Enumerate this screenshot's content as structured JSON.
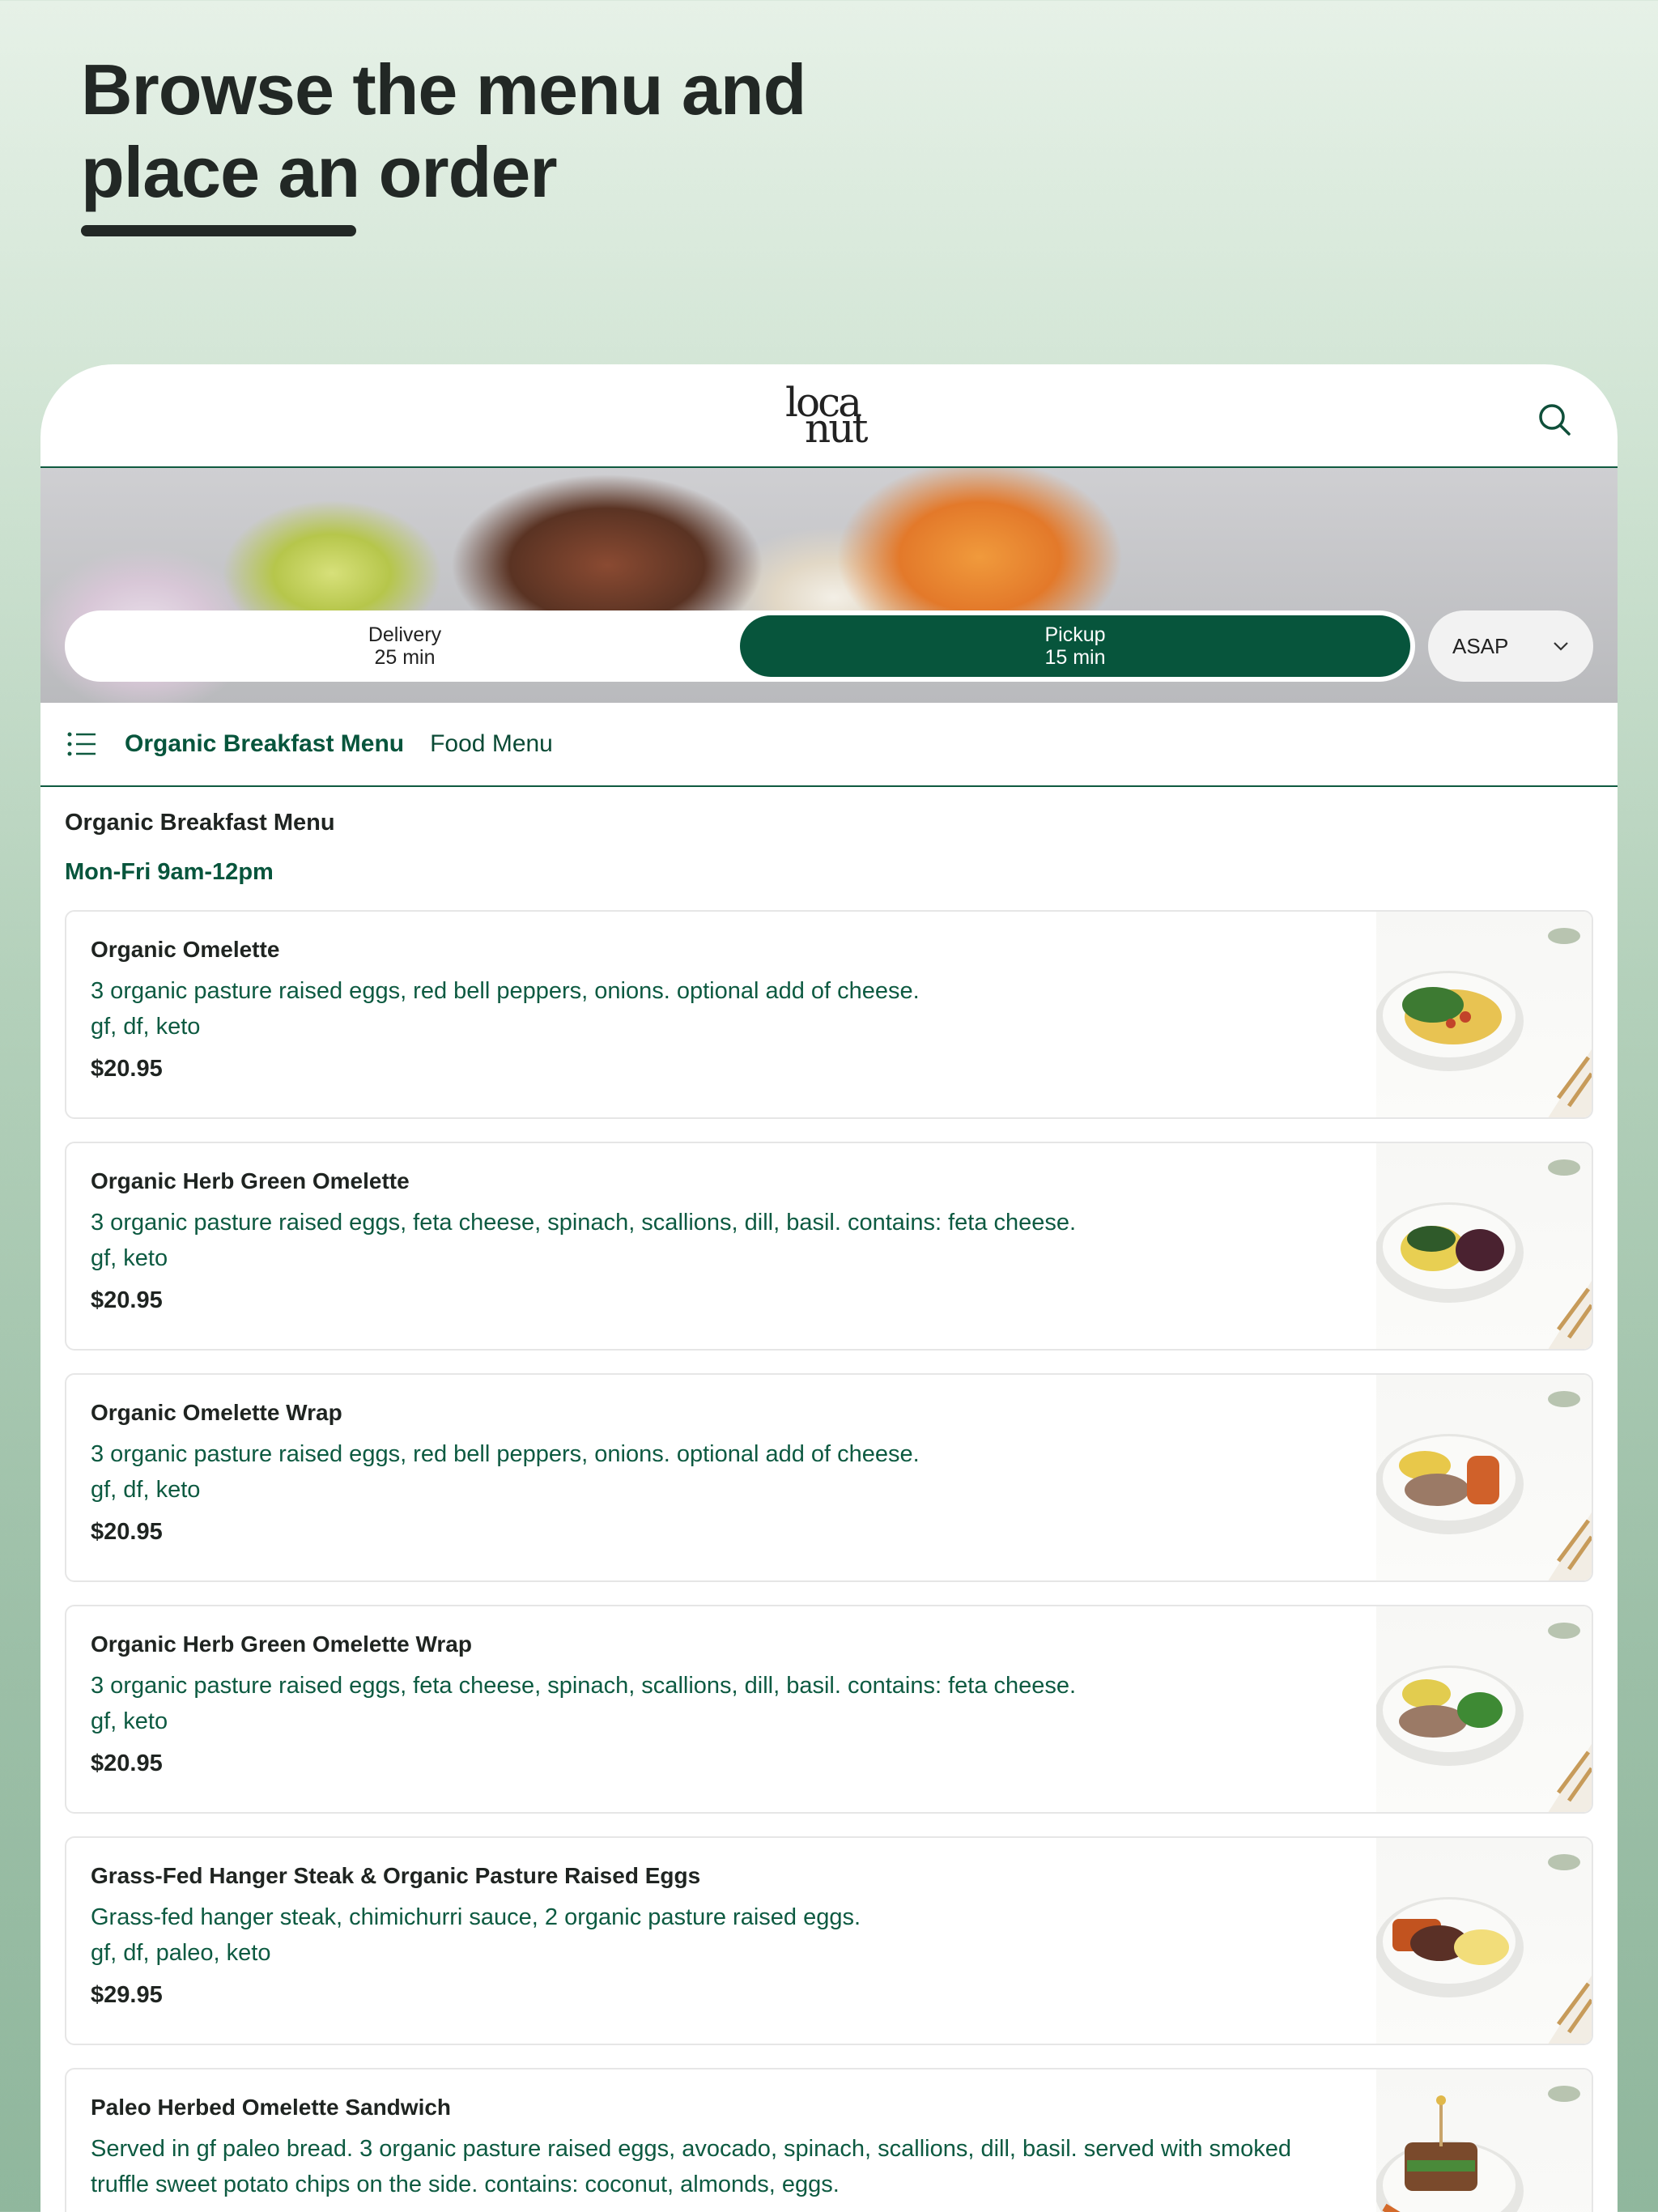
{
  "page": {
    "headline_line1": "Browse the menu and",
    "headline_line2": "place an order"
  },
  "app": {
    "logo_line1": "loca",
    "logo_line2": "nut",
    "search_icon": "search-icon"
  },
  "order_mode": {
    "delivery_label": "Delivery",
    "delivery_time": "25 min",
    "pickup_label": "Pickup",
    "pickup_time": "15 min",
    "selected": "Pickup",
    "time_select_value": "ASAP"
  },
  "category_nav": {
    "icon": "list-icon",
    "items": [
      {
        "label": "Organic Breakfast Menu",
        "active": true
      },
      {
        "label": "Food Menu",
        "active": false
      }
    ]
  },
  "section": {
    "title": "Organic Breakfast Menu",
    "hours": "Mon-Fri 9am-12pm"
  },
  "menu_items": [
    {
      "name": "Organic Omelette",
      "description": "3 organic pasture raised eggs, red bell peppers, onions. optional add of cheese.",
      "tags": "gf, df, keto",
      "price": "$20.95"
    },
    {
      "name": "Organic Herb Green Omelette",
      "description": "3 organic pasture raised eggs, feta cheese, spinach, scallions, dill, basil. contains: feta cheese.",
      "tags": "gf, keto",
      "price": "$20.95"
    },
    {
      "name": "Organic Omelette Wrap",
      "description": "3 organic pasture raised eggs, red bell peppers, onions. optional add of cheese.",
      "tags": "gf, df, keto",
      "price": "$20.95"
    },
    {
      "name": "Organic Herb Green Omelette Wrap",
      "description": "3 organic pasture raised eggs, feta cheese, spinach, scallions, dill, basil. contains: feta cheese.",
      "tags": "gf, keto",
      "price": "$20.95"
    },
    {
      "name": "Grass-Fed Hanger Steak & Organic Pasture Raised Eggs",
      "description": "Grass-fed hanger steak, chimichurri sauce, 2 organic pasture raised eggs.",
      "tags": "gf, df, paleo, keto",
      "price": "$29.95"
    },
    {
      "name": "Paleo Herbed Omelette Sandwich",
      "description": "Served in gf paleo bread. 3 organic pasture raised eggs, avocado, spinach, scallions, dill, basil. served with smoked truffle sweet potato chips on the side. contains: coconut, almonds, eggs.",
      "tags": "",
      "price": ""
    }
  ],
  "colors": {
    "brand_green": "#07553c",
    "text_green": "#0d5a41"
  }
}
